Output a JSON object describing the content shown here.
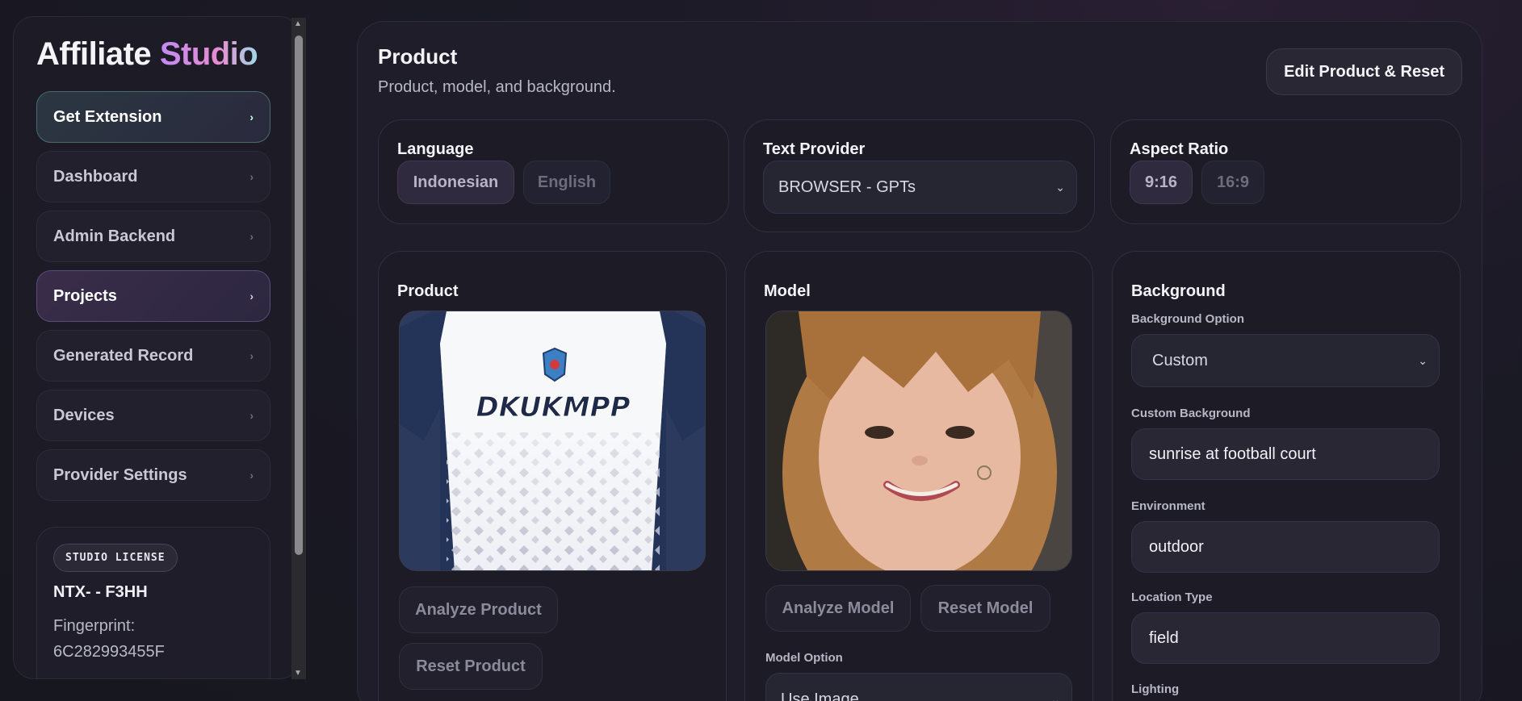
{
  "brand": {
    "name_part1": "Affiliate",
    "name_part2": "Studio"
  },
  "sidebar": {
    "items": [
      {
        "label": "Get Extension",
        "chevron": "›"
      },
      {
        "label": "Dashboard",
        "chevron": "›"
      },
      {
        "label": "Admin Backend",
        "chevron": "›"
      },
      {
        "label": "Projects",
        "chevron": "›"
      },
      {
        "label": "Generated Record",
        "chevron": "›"
      },
      {
        "label": "Devices",
        "chevron": "›"
      },
      {
        "label": "Provider Settings",
        "chevron": "›"
      }
    ],
    "active_item": "Projects"
  },
  "license": {
    "badge": "STUDIO LICENSE",
    "key": "NTX- - F3HH",
    "fingerprint_label": "Fingerprint:",
    "fingerprint_value": "6C282993455F"
  },
  "header": {
    "title": "Product",
    "subtitle": "Product, model, and background.",
    "edit_button": "Edit Product & Reset"
  },
  "language": {
    "title": "Language",
    "options": [
      "Indonesian",
      "English"
    ],
    "selected": "Indonesian"
  },
  "text_provider": {
    "title": "Text Provider",
    "value": "BROWSER - GPTs"
  },
  "aspect_ratio": {
    "title": "Aspect Ratio",
    "options": [
      "9:16",
      "16:9"
    ],
    "selected": "9:16"
  },
  "product": {
    "title": "Product",
    "image_text": "DKUKMPP",
    "analyze_button": "Analyze Product",
    "reset_button": "Reset Product"
  },
  "model": {
    "title": "Model",
    "analyze_button": "Analyze Model",
    "reset_button": "Reset Model",
    "option_label": "Model Option",
    "option_value": "Use Image"
  },
  "background": {
    "title": "Background",
    "option_label": "Background Option",
    "option_value": "Custom",
    "custom_label": "Custom Background",
    "custom_value": "sunrise at football court",
    "environment_label": "Environment",
    "environment_value": "outdoor",
    "location_label": "Location Type",
    "location_value": "field",
    "lighting_label": "Lighting"
  },
  "colors": {
    "accent_purple": "#c08bf4",
    "accent_teal": "#9fd8e8",
    "panel_bg": "#1e1d29"
  }
}
